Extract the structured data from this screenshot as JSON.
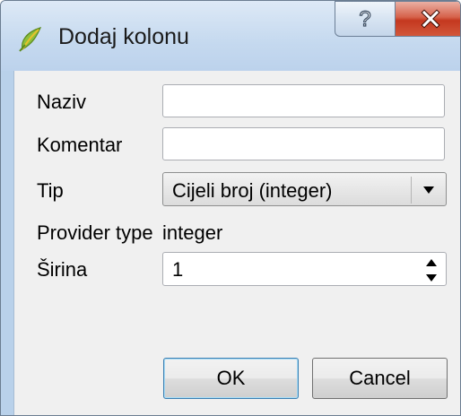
{
  "window": {
    "title": "Dodaj kolonu",
    "help_symbol": "?",
    "close_symbol": "X"
  },
  "icons": {
    "app": "qgis-leaf-icon",
    "help": "help-icon",
    "close": "close-icon",
    "dropdown": "chevron-down-icon",
    "spin_up": "triangle-up-icon",
    "spin_down": "triangle-down-icon"
  },
  "form": {
    "name_label": "Naziv",
    "name_value": "",
    "comment_label": "Komentar",
    "comment_value": "",
    "type_label": "Tip",
    "type_value": "Cijeli broj (integer)",
    "provider_type_label": "Provider type",
    "provider_type_value": "integer",
    "width_label": "Širina",
    "width_value": "1"
  },
  "buttons": {
    "ok": "OK",
    "cancel": "Cancel"
  },
  "colors": {
    "close_button": "#c4381f",
    "title_bar": "#c5d9ef",
    "dialog_background": "#f0f0f0"
  }
}
